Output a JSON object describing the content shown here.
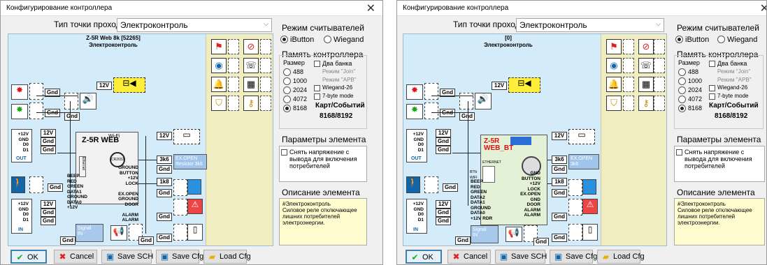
{
  "left": {
    "title": "Конфигурирование контроллера",
    "type_label": "Тип точки прохода",
    "type_value": "Электроконтроль",
    "device_name": "Z-5R Web 8k [52265]",
    "device_sub": "Электроконтроль",
    "board_model": "Z-5R WEB",
    "wifi": "Wi-Fi",
    "battery": "CR2032",
    "ethernet": "Ethernet",
    "out_pins": "+12V\nGND\nD0\nD1",
    "out_label": "OUT",
    "in_pins": "+12V\nGND\nD0\nD1",
    "in_label": "IN",
    "left_pins": "BEEP\nRED\nGREEN\nDATA1\nGROUND\nDATA0\n+12V",
    "right_pins": "GROUND\nBUTTON\n+12V\nLOCK\n\nEX.OPEN\nGROUND\nDOOR\n\nALARM\nALARM",
    "exopen": "EX.OPEN\nResistor 3k6",
    "signal": "Signal\nIN",
    "buttons": {
      "ok": "OK",
      "cancel": "Cancel",
      "savesch": "Save SCH",
      "savecfg": "Save Cfg",
      "loadcfg": "Load Cfg"
    }
  },
  "right": {
    "title": "Конфигурирование контроллера",
    "type_label": "Тип точки прохода",
    "type_value": "Электроконтроль",
    "device_name": "[0]",
    "device_sub": "Электроконтроль",
    "board_model": "Z-5R\nWEB_BT",
    "ethernet": "ETHERNET",
    "btn": "BTN",
    "wifi": "WIFI",
    "out_pins": "+12V\nGND\nD0\nD1",
    "out_label": "OUT",
    "in_pins": "+12V\nGND\nD0\nD1",
    "in_label": "IN",
    "left_pins": "BEEP\nRED\nGREEN\nDATA2\nDATA1\nGROUND\nDATA0\n+12V RDR",
    "right_pins": "GND\nBUTTON\n+12V\nLOCK\nEX.OPEN\nGND\nDOOR\nALARM\nALARM",
    "exopen": "EX.OPEN\n3k6",
    "signal": "Signal\nIN",
    "buttons": {
      "ok": "OK",
      "cancel": "Cancel",
      "savesch": "Save SCH",
      "savecfg": "Save Cfg",
      "loadcfg": "Load Cfg"
    }
  },
  "shared": {
    "gnd": "Gnd",
    "v12": "12V",
    "r3k6": "3k6",
    "r1k8": "1k8",
    "readers_mode": "Режим считывателей",
    "ibutton": "iButton",
    "wiegand": "Wiegand",
    "memory": "Память контроллера",
    "size_label": "Размер",
    "sizes": [
      "488",
      "1000",
      "2024",
      "4072",
      "8168"
    ],
    "two_banks": "Два банка",
    "join_mode": "Режим \"Join\"",
    "apb_mode": "Режим \"APB\"",
    "wiegand26": "Wiegand-26",
    "byte7": "7-byte mode",
    "cards_events": "Карт/Событий",
    "cards_value": "8168/8192",
    "params": "Параметры элемента",
    "power_off": "Снять напряжение с вывода для включения потребителей",
    "description": "Описание элемента",
    "desc_text": "#Электроконтроль\nСиловое реле отключающее лишних потребителей электроэнергии."
  }
}
